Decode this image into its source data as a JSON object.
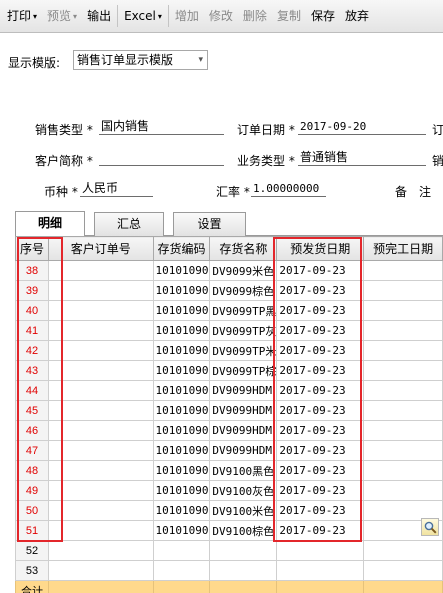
{
  "toolbar": {
    "buttons": [
      {
        "label": "打印",
        "caret": true,
        "enabled": true
      },
      {
        "label": "预览",
        "caret": true,
        "enabled": false
      },
      {
        "label": "输出",
        "caret": false,
        "enabled": true
      },
      {
        "label": "Excel",
        "caret": true,
        "enabled": true
      },
      {
        "label": "增加",
        "caret": false,
        "enabled": false
      },
      {
        "label": "修改",
        "caret": false,
        "enabled": false
      },
      {
        "label": "删除",
        "caret": false,
        "enabled": false
      },
      {
        "label": "复制",
        "caret": false,
        "enabled": false
      },
      {
        "label": "保存",
        "caret": false,
        "enabled": true
      },
      {
        "label": "放弃",
        "caret": false,
        "enabled": true
      }
    ],
    "caret_glyph": "▾"
  },
  "template": {
    "label": "显示模版:",
    "selected": "销售订单显示模版",
    "caret_glyph": "▾"
  },
  "header": {
    "sales_type": {
      "label": "销售类型",
      "star": "*",
      "value": "国内销售"
    },
    "order_date": {
      "label": "订单日期",
      "star": "*",
      "value": "2017-09-20"
    },
    "cut_label_1": "订",
    "customer": {
      "label": "客户简称",
      "star": "*",
      "value": ""
    },
    "biz_type": {
      "label": "业务类型",
      "star": "*",
      "value": "普通销售"
    },
    "cut_label_2": "销",
    "currency": {
      "label": "币种",
      "star": "*",
      "value": "人民币"
    },
    "rate": {
      "label": "汇率",
      "star": "*",
      "value": "1.00000000"
    },
    "note_label": "备　注"
  },
  "tabs": [
    {
      "label": "明细",
      "active": true
    },
    {
      "label": "汇总",
      "active": false
    },
    {
      "label": "设置",
      "active": false
    }
  ],
  "grid": {
    "columns": [
      "序号",
      "客户订单号",
      "存货编码",
      "存货名称",
      "预发货日期",
      "预完工日期"
    ],
    "rows": [
      {
        "seq": "38",
        "cust": "",
        "code": "10101090",
        "name": "DV9099米色",
        "ship": "2017-09-23",
        "done": ""
      },
      {
        "seq": "39",
        "cust": "",
        "code": "10101090",
        "name": "DV9099棕色",
        "ship": "2017-09-23",
        "done": ""
      },
      {
        "seq": "40",
        "cust": "",
        "code": "10101090",
        "name": "DV9099TP黑",
        "ship": "2017-09-23",
        "done": ""
      },
      {
        "seq": "41",
        "cust": "",
        "code": "10101090",
        "name": "DV9099TP灰",
        "ship": "2017-09-23",
        "done": ""
      },
      {
        "seq": "42",
        "cust": "",
        "code": "10101090",
        "name": "DV9099TP米",
        "ship": "2017-09-23",
        "done": ""
      },
      {
        "seq": "43",
        "cust": "",
        "code": "10101090",
        "name": "DV9099TP棕",
        "ship": "2017-09-23",
        "done": ""
      },
      {
        "seq": "44",
        "cust": "",
        "code": "10101090",
        "name": "DV9099HDM",
        "ship": "2017-09-23",
        "done": ""
      },
      {
        "seq": "45",
        "cust": "",
        "code": "10101090",
        "name": "DV9099HDM",
        "ship": "2017-09-23",
        "done": ""
      },
      {
        "seq": "46",
        "cust": "",
        "code": "10101090",
        "name": "DV9099HDM",
        "ship": "2017-09-23",
        "done": ""
      },
      {
        "seq": "47",
        "cust": "",
        "code": "10101090",
        "name": "DV9099HDM",
        "ship": "2017-09-23",
        "done": ""
      },
      {
        "seq": "48",
        "cust": "",
        "code": "10101090",
        "name": "DV9100黑色",
        "ship": "2017-09-23",
        "done": ""
      },
      {
        "seq": "49",
        "cust": "",
        "code": "10101090",
        "name": "DV9100灰色",
        "ship": "2017-09-23",
        "done": ""
      },
      {
        "seq": "50",
        "cust": "",
        "code": "10101090",
        "name": "DV9100米色",
        "ship": "2017-09-23",
        "done": ""
      },
      {
        "seq": "51",
        "cust": "",
        "code": "10101090",
        "name": "DV9100棕色",
        "ship": "2017-09-23",
        "done": ""
      },
      {
        "seq": "52",
        "cust": "",
        "code": "",
        "name": "",
        "ship": "",
        "done": ""
      },
      {
        "seq": "53",
        "cust": "",
        "code": "",
        "name": "",
        "ship": "",
        "done": ""
      }
    ],
    "total_label": "合计"
  },
  "colors": {
    "highlight": "#e3262b",
    "seq_text": "#e00000",
    "total_row": "#ffd98c"
  }
}
